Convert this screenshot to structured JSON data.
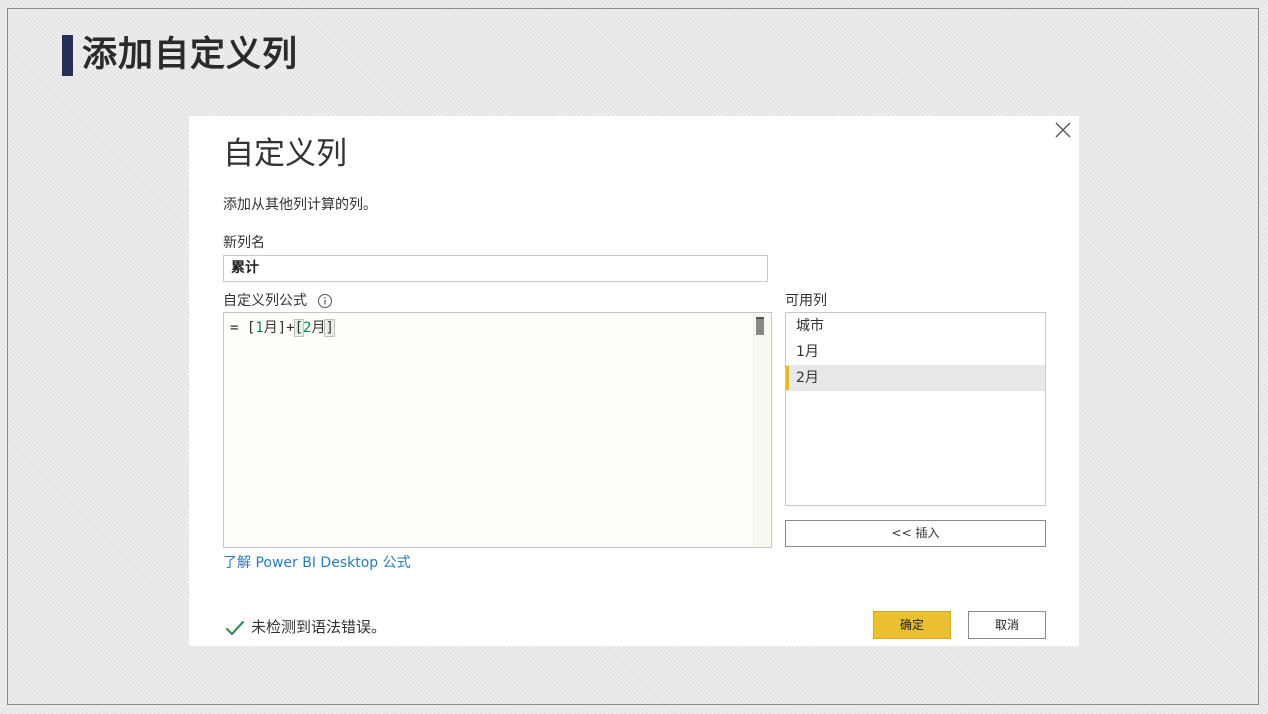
{
  "slide": {
    "title": "添加自定义列"
  },
  "dialog": {
    "title": "自定义列",
    "description": "添加从其他列计算的列。",
    "new_column_label": "新列名",
    "new_column_value": "累计",
    "formula_label": "自定义列公式",
    "formula": {
      "eq": "= ",
      "tok1_open": "[",
      "tok1_num": "1",
      "tok1_text": "月",
      "tok1_close": "]",
      "plus": "+",
      "tok2_open": "[",
      "tok2_num": "2",
      "tok2_text": "月",
      "tok2_close": "]"
    },
    "available_columns_label": "可用列",
    "available_columns": [
      "城市",
      "1月",
      "2月"
    ],
    "selected_column": "2月",
    "insert_button": "<< 插入",
    "learn_link": "了解 Power BI Desktop 公式",
    "status": "未检测到语法错误。",
    "ok_button": "确定",
    "cancel_button": "取消"
  },
  "colors": {
    "accent": "#eabf32",
    "title_bar": "#243056",
    "link": "#2a7abf",
    "success": "#3a8a5a"
  },
  "icons": [
    "close-icon",
    "info-icon",
    "check-icon"
  ]
}
